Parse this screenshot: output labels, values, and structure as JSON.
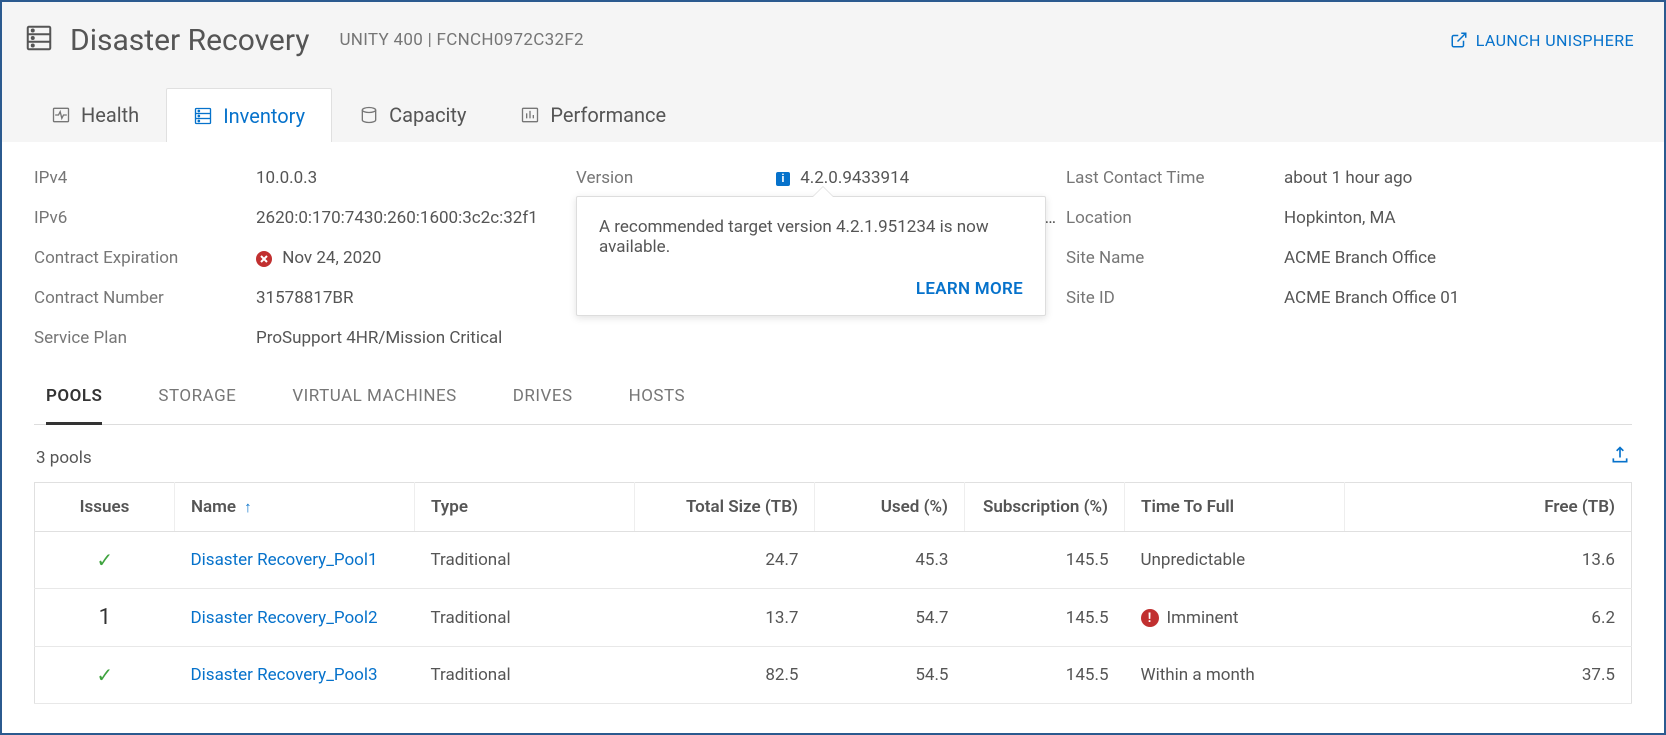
{
  "header": {
    "title": "Disaster Recovery",
    "system_meta": "UNITY 400 | FCNCH0972C32F2",
    "launch_label": "LAUNCH UNISPHERE"
  },
  "tabs": {
    "health": "Health",
    "inventory": "Inventory",
    "capacity": "Capacity",
    "performance": "Performance"
  },
  "details": {
    "ipv4_label": "IPv4",
    "ipv4_value": "10.0.0.3",
    "ipv6_label": "IPv6",
    "ipv6_value": "2620:0:170:7430:260:1600:3c2c:32f1",
    "contract_exp_label": "Contract Expiration",
    "contract_exp_value": "Nov 24, 2020",
    "contract_num_label": "Contract Number",
    "contract_num_value": "31578817BR",
    "service_plan_label": "Service Plan",
    "service_plan_value": "ProSupport 4HR/Mission Critical",
    "version_label": "Version",
    "version_value": "4.2.0.9433914",
    "hotfixes_trunc": "1…",
    "last_contact_label": "Last Contact Time",
    "last_contact_value": "about 1 hour ago",
    "location_label": "Location",
    "location_value": "Hopkinton, MA",
    "site_name_label": "Site Name",
    "site_name_value": "ACME Branch Office",
    "site_id_label": "Site ID",
    "site_id_value": "ACME Branch Office 01"
  },
  "popover": {
    "message": "A recommended target version 4.2.1.951234 is now available.",
    "action": "LEARN MORE"
  },
  "subtabs": {
    "pools": "POOLS",
    "storage": "STORAGE",
    "virtual_machines": "VIRTUAL MACHINES",
    "drives": "DRIVES",
    "hosts": "HOSTS"
  },
  "table": {
    "count_label": "3 pools",
    "headers": {
      "issues": "Issues",
      "name": "Name",
      "type": "Type",
      "total_size": "Total Size (TB)",
      "used": "Used (%)",
      "subscription": "Subscription (%)",
      "time_to_full": "Time To Full",
      "free": "Free (TB)"
    },
    "rows": [
      {
        "issues": "ok",
        "name": "Disaster Recovery_Pool1",
        "type": "Traditional",
        "total_size": "24.7",
        "used": "45.3",
        "subscription": "145.5",
        "time_to_full": "Unpredictable",
        "ttf_alert": false,
        "free": "13.6"
      },
      {
        "issues": "1",
        "name": "Disaster Recovery_Pool2",
        "type": "Traditional",
        "total_size": "13.7",
        "used": "54.7",
        "subscription": "145.5",
        "time_to_full": "Imminent",
        "ttf_alert": true,
        "free": "6.2"
      },
      {
        "issues": "ok",
        "name": "Disaster Recovery_Pool3",
        "type": "Traditional",
        "total_size": "82.5",
        "used": "54.5",
        "subscription": "145.5",
        "time_to_full": "Within a month",
        "ttf_alert": false,
        "free": "37.5"
      }
    ]
  }
}
